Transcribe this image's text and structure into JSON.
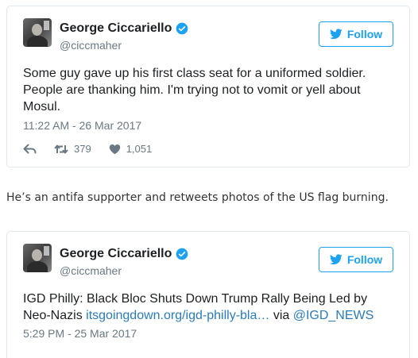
{
  "tweets": [
    {
      "display_name": "George Ciccariello",
      "screen_name": "@ciccmaher",
      "follow_label": "Follow",
      "text": "Some guy gave up his first class seat for a uniformed soldier. People are thanking him. I'm trying not to vomit or yell about Mosul.",
      "timestamp": "11:22 AM - 26 Mar 2017",
      "retweets": "379",
      "likes": "1,051"
    },
    {
      "display_name": "George Ciccariello",
      "screen_name": "@ciccmaher",
      "follow_label": "Follow",
      "text_prefix": "IGD Philly: Black Bloc Shuts Down Trump Rally Being Led by Neo-Nazis ",
      "link_text": "itsgoingdown.org/igd-philly-bla…",
      "text_via": " via ",
      "mention": "@IGD_NEWS",
      "timestamp": "5:29 PM - 25 Mar 2017"
    }
  ],
  "article_text": "He’s an antifa supporter and retweets photos of the US flag burning.",
  "colors": {
    "accent": "#1da1f2",
    "link": "#2b7bb9",
    "muted": "#697882",
    "border": "#e1e8ed"
  },
  "icons": {
    "verified": "verified-badge-icon",
    "follow": "twitter-bird-icon",
    "reply": "reply-icon",
    "retweet": "retweet-icon",
    "like": "heart-icon"
  }
}
